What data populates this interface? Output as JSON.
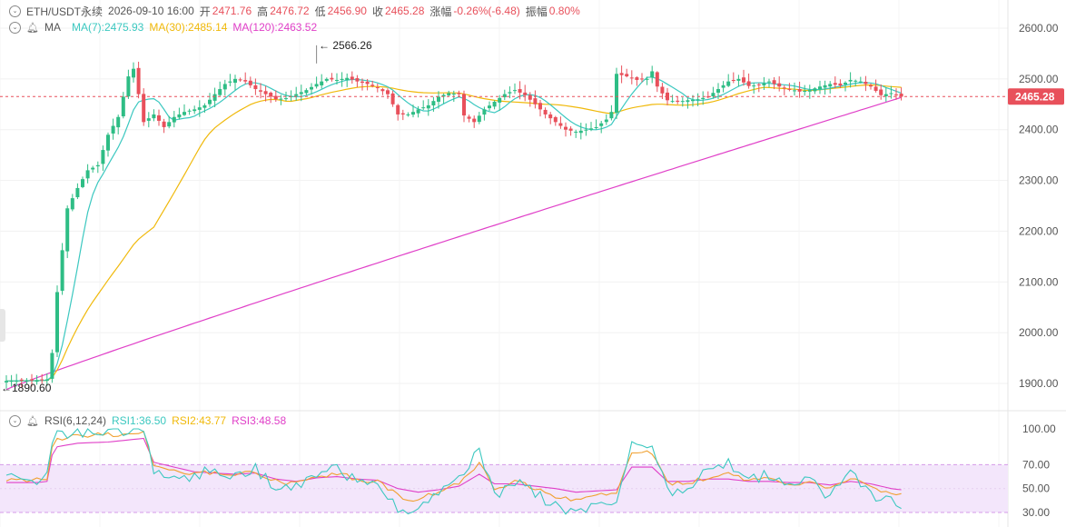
{
  "header": {
    "symbol": "ETH/USDT永续",
    "datetime": "2026-09-10 16:00",
    "open_label": "开",
    "open": "2471.76",
    "high_label": "高",
    "high": "2476.72",
    "low_label": "低",
    "low": "2456.90",
    "close_label": "收",
    "close": "2465.28",
    "change_label": "涨幅",
    "change": "-0.26%(-6.48)",
    "amplitude_label": "振幅",
    "amplitude": "0.80%"
  },
  "ma_legend": {
    "label": "MA",
    "ma7": "MA(7):2475.93",
    "ma30": "MA(30):2485.14",
    "ma120": "MA(120):2463.52"
  },
  "rsi_legend": {
    "label": "RSI(6,12,24)",
    "rsi1": "RSI1:36.50",
    "rsi2": "RSI2:43.77",
    "rsi3": "RSI3:48.58"
  },
  "colors": {
    "up": "#2ebd85",
    "down": "#e8505b",
    "ma7": "#3cc8c0",
    "ma30": "#f0b90b",
    "ma120": "#e040c8",
    "rsi1": "#3cc8c0",
    "rsi2": "#f0a030",
    "rsi3": "#e040c8",
    "rsi_band": "#f3e6fb"
  },
  "chart_data": {
    "type": "candlestick",
    "price_axis": {
      "ticks": [
        "2600.00",
        "2500.00",
        "2400.00",
        "2300.00",
        "2200.00",
        "2100.00",
        "2000.00",
        "1900.00"
      ],
      "range": [
        1880,
        2640
      ]
    },
    "last_price": "2465.28",
    "annotations": {
      "max": "2566.26",
      "min": "1890.60"
    },
    "rsi_axis": {
      "ticks": [
        "100.00",
        "70.00",
        "50.00",
        "30.00"
      ],
      "range": [
        25,
        105
      ],
      "band": [
        30,
        70
      ]
    },
    "ohlc_anchor": [
      [
        0,
        1905
      ],
      [
        6,
        1906
      ],
      [
        8,
        1908
      ],
      [
        9,
        1960
      ],
      [
        10,
        2080
      ],
      [
        12,
        2245
      ],
      [
        14,
        2285
      ],
      [
        16,
        2320
      ],
      [
        18,
        2330
      ],
      [
        20,
        2390
      ],
      [
        22,
        2425
      ],
      [
        24,
        2505
      ],
      [
        25,
        2520
      ],
      [
        26,
        2470
      ],
      [
        27,
        2415
      ],
      [
        29,
        2430
      ],
      [
        31,
        2405
      ],
      [
        33,
        2425
      ],
      [
        35,
        2435
      ],
      [
        37,
        2440
      ],
      [
        39,
        2448
      ],
      [
        41,
        2470
      ],
      [
        43,
        2490
      ],
      [
        45,
        2500
      ],
      [
        47,
        2495
      ],
      [
        49,
        2480
      ],
      [
        51,
        2470
      ],
      [
        53,
        2460
      ],
      [
        55,
        2462
      ],
      [
        57,
        2470
      ],
      [
        59,
        2478
      ],
      [
        61,
        2490
      ],
      [
        63,
        2500
      ],
      [
        65,
        2498
      ],
      [
        67,
        2502
      ],
      [
        69,
        2495
      ],
      [
        71,
        2490
      ],
      [
        73,
        2482
      ],
      [
        75,
        2470
      ],
      [
        77,
        2430
      ],
      [
        79,
        2430
      ],
      [
        81,
        2440
      ],
      [
        83,
        2448
      ],
      [
        85,
        2465
      ],
      [
        87,
        2472
      ],
      [
        89,
        2470
      ],
      [
        90,
        2428
      ],
      [
        92,
        2415
      ],
      [
        94,
        2440
      ],
      [
        96,
        2455
      ],
      [
        98,
        2470
      ],
      [
        100,
        2478
      ],
      [
        102,
        2468
      ],
      [
        104,
        2450
      ],
      [
        106,
        2430
      ],
      [
        108,
        2415
      ],
      [
        110,
        2400
      ],
      [
        112,
        2396
      ],
      [
        114,
        2400
      ],
      [
        116,
        2405
      ],
      [
        118,
        2420
      ],
      [
        119,
        2435
      ],
      [
        120,
        2510
      ],
      [
        122,
        2505
      ],
      [
        124,
        2498
      ],
      [
        126,
        2500
      ],
      [
        127,
        2515
      ],
      [
        128,
        2485
      ],
      [
        130,
        2458
      ],
      [
        132,
        2455
      ],
      [
        134,
        2458
      ],
      [
        136,
        2460
      ],
      [
        138,
        2465
      ],
      [
        140,
        2480
      ],
      [
        142,
        2495
      ],
      [
        144,
        2500
      ],
      [
        146,
        2486
      ],
      [
        148,
        2488
      ],
      [
        150,
        2495
      ],
      [
        152,
        2485
      ],
      [
        154,
        2480
      ],
      [
        156,
        2475
      ],
      [
        158,
        2478
      ],
      [
        160,
        2485
      ],
      [
        162,
        2490
      ],
      [
        164,
        2487
      ],
      [
        166,
        2498
      ],
      [
        168,
        2495
      ],
      [
        170,
        2485
      ],
      [
        172,
        2468
      ],
      [
        174,
        2472
      ],
      [
        176,
        2465
      ]
    ],
    "rsi_anchor": [
      [
        0,
        62,
        58,
        55
      ],
      [
        6,
        58,
        57,
        55
      ],
      [
        8,
        60,
        58,
        56
      ],
      [
        9,
        92,
        86,
        78
      ],
      [
        10,
        96,
        92,
        85
      ],
      [
        14,
        98,
        94,
        88
      ],
      [
        20,
        98,
        95,
        89
      ],
      [
        27,
        100,
        97,
        92
      ],
      [
        29,
        64,
        70,
        72
      ],
      [
        33,
        58,
        64,
        68
      ],
      [
        37,
        62,
        62,
        64
      ],
      [
        41,
        66,
        64,
        63
      ],
      [
        45,
        62,
        62,
        62
      ],
      [
        49,
        66,
        64,
        63
      ],
      [
        53,
        52,
        56,
        58
      ],
      [
        57,
        50,
        54,
        56
      ],
      [
        61,
        60,
        60,
        59
      ],
      [
        65,
        66,
        63,
        60
      ],
      [
        69,
        56,
        58,
        58
      ],
      [
        73,
        52,
        56,
        57
      ],
      [
        77,
        34,
        44,
        50
      ],
      [
        81,
        30,
        40,
        47
      ],
      [
        85,
        48,
        48,
        49
      ],
      [
        89,
        56,
        54,
        52
      ],
      [
        93,
        86,
        72,
        62
      ],
      [
        96,
        42,
        50,
        54
      ],
      [
        100,
        56,
        56,
        54
      ],
      [
        104,
        46,
        50,
        52
      ],
      [
        108,
        36,
        44,
        50
      ],
      [
        112,
        30,
        40,
        47
      ],
      [
        116,
        38,
        44,
        48
      ],
      [
        120,
        40,
        46,
        49
      ],
      [
        123,
        88,
        80,
        68
      ],
      [
        127,
        88,
        80,
        68
      ],
      [
        130,
        48,
        54,
        56
      ],
      [
        134,
        52,
        54,
        56
      ],
      [
        138,
        64,
        60,
        58
      ],
      [
        142,
        72,
        62,
        58
      ],
      [
        146,
        58,
        56,
        56
      ],
      [
        150,
        62,
        58,
        56
      ],
      [
        154,
        52,
        54,
        55
      ],
      [
        158,
        56,
        56,
        55
      ],
      [
        162,
        44,
        50,
        53
      ],
      [
        166,
        66,
        60,
        56
      ],
      [
        170,
        46,
        52,
        54
      ],
      [
        174,
        40,
        46,
        50
      ],
      [
        176,
        36,
        44,
        49
      ]
    ]
  }
}
